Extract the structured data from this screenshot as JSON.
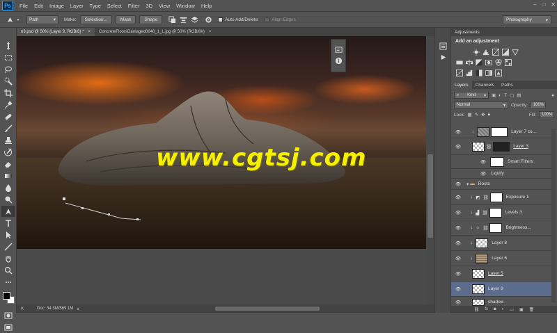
{
  "app": {
    "logo": "Ps"
  },
  "menu": [
    "File",
    "Edit",
    "Image",
    "Layer",
    "Type",
    "Select",
    "Filter",
    "3D",
    "View",
    "Window",
    "Help"
  ],
  "window_controls": {
    "minimize": "–",
    "maximize": "□",
    "close": "✕"
  },
  "options": {
    "mode_value": "Path",
    "make_label": "Make:",
    "selection_button": "Selection...",
    "mask_button": "Mask",
    "shape_button": "Shape",
    "auto_add_delete": "Auto Add/Delete",
    "align_edges": "Align Edges",
    "workspace": "Photography"
  },
  "tabs": [
    {
      "label": "n3.psd @ 50% (Layer 9, RGB/8) *",
      "close": "×"
    },
    {
      "label": "ConcreteFloorsDamaged0040_1_L.jpg @ 50% (RGB/8#)",
      "close": "×"
    }
  ],
  "watermark": "www.cgtsj.com",
  "status": {
    "doc": "Doc: 34.3M/569.1M"
  },
  "adjustments": {
    "header": "Adjustments",
    "subtitle": "Add an adjustment"
  },
  "layers_panel": {
    "tabs": [
      "Layers",
      "Channels",
      "Paths"
    ],
    "kind": "Kind",
    "blend_mode": "Normal",
    "opacity_label": "Opacity:",
    "opacity_value": "100%",
    "lock_label": "Lock:",
    "fill_label": "Fill:",
    "fill_value": "100%",
    "layers": [
      {
        "name": "Layer 7 co..."
      },
      {
        "name": "Layer 3"
      },
      {
        "name": "Smart Filters"
      },
      {
        "name": "Liquify"
      },
      {
        "name": "Roots"
      },
      {
        "name": "Exposure 1"
      },
      {
        "name": "Levels 3"
      },
      {
        "name": "Brightness..."
      },
      {
        "name": "Layer 8"
      },
      {
        "name": "Layer 6"
      },
      {
        "name": "Layer 5"
      },
      {
        "name": "Layer 9"
      },
      {
        "name": "shadow"
      }
    ]
  },
  "colors": {
    "accent": "#31a8ff",
    "selected_layer": "#5c6c8c",
    "watermark": "#f5f000"
  }
}
